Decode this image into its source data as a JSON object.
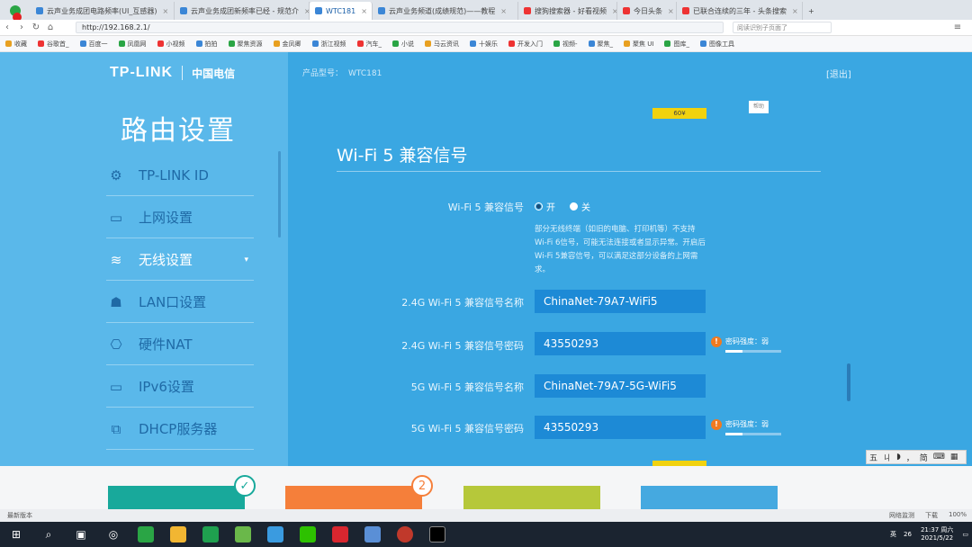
{
  "browser": {
    "tabs": [
      {
        "label": "云声业务成团电路频率(UI_互感器)",
        "active": false
      },
      {
        "label": "云声业务成团新频率已经 - 规范介",
        "active": false
      },
      {
        "label": "WTC181",
        "active": true
      },
      {
        "label": "云声业务频道(成绩规范)——教程",
        "active": false
      },
      {
        "label": "搜狗搜索器 - 好看视频",
        "active": false
      },
      {
        "label": "今日头条",
        "active": false
      },
      {
        "label": "已联合连续的三年 - 头条搜索",
        "active": false
      }
    ],
    "url": "http://192.168.2.1/",
    "search_placeholder": "阅读识别子页面了",
    "bookmarks": [
      "收藏",
      "谷歌首_",
      "百度一",
      "凤凰网",
      "小视频",
      "拍拍",
      "聚焦资源",
      "金凤卿",
      "浙江视频",
      "汽车_",
      "小说",
      "马云资讯",
      "十娱乐",
      "开发入门",
      "视频-",
      "聚焦_",
      "聚焦 UI",
      "图库_",
      "图像工具"
    ],
    "new_tab": "+"
  },
  "router": {
    "brand": "TP-LINK",
    "telecom": "中国电信",
    "sidebar_title": "路由设置",
    "menu": [
      {
        "icon": "gear-icon",
        "glyph": "⚙",
        "label": "TP-LINK ID",
        "active": false
      },
      {
        "icon": "monitor-icon",
        "glyph": "▭",
        "label": "上网设置",
        "active": false
      },
      {
        "icon": "wifi-icon",
        "glyph": "≋",
        "label": "无线设置",
        "active": true
      },
      {
        "icon": "lan-icon",
        "glyph": "☗",
        "label": "LAN口设置",
        "active": false
      },
      {
        "icon": "nat-icon",
        "glyph": "⎔",
        "label": "硬件NAT",
        "active": false
      },
      {
        "icon": "monitor-icon",
        "glyph": "▭",
        "label": "IPv6设置",
        "active": false
      },
      {
        "icon": "dhcp-icon",
        "glyph": "⧉",
        "label": "DHCP服务器",
        "active": false
      }
    ],
    "product_model_label": "产品型号：",
    "product_model": "WTC181",
    "exit": "[退出]",
    "tag_yellow": "60¥",
    "tag_white": "帮助",
    "section_title": "Wi-Fi 5 兼容信号",
    "fields": {
      "compat_label": "Wi-Fi 5 兼容信号",
      "opt_on": "开",
      "opt_off": "关",
      "help": "部分无线终端（如旧的电脑、打印机等）不支持Wi-Fi 6信号，可能无法连接或者显示异常。开启后Wi-Fi 5兼容信号，可以满足这部分设备的上网需求。",
      "name24_label": "2.4G Wi-Fi 5 兼容信号名称",
      "name24_value": "ChinaNet-79A7-WiFi5",
      "pwd24_label": "2.4G Wi-Fi 5 兼容信号密码",
      "pwd24_value": "43550293",
      "name5_label": "5G Wi-Fi 5 兼容信号名称",
      "name5_value": "ChinaNet-79A7-5G-WiFi5",
      "pwd5_label": "5G Wi-Fi 5 兼容信号密码",
      "pwd5_value": "43550293",
      "strength_text": "密码强度：弱",
      "strength_level": 0.3
    }
  },
  "steps": {
    "badge1": "✓",
    "badge2": "2",
    "colors": [
      "#18a99b",
      "#f57f3a",
      "#b6c83a",
      "#45a9e0"
    ]
  },
  "ime": [
    "五",
    "ㄐ",
    "◗",
    "，",
    "简",
    "⌨",
    "▦"
  ],
  "statusbar": {
    "left": "最新版本",
    "items": [
      "网络监测",
      "下载",
      "100%"
    ]
  },
  "taskbar": {
    "tray": [
      "英",
      "26"
    ],
    "time": "21:37 周六",
    "date": "2021/5/22"
  }
}
